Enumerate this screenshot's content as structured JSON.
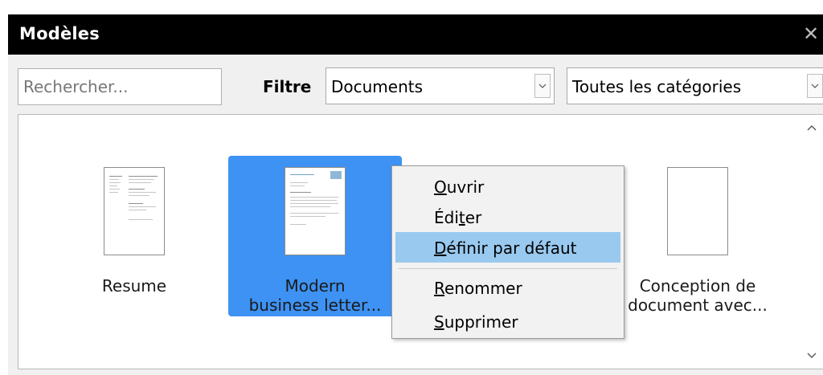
{
  "window": {
    "title": "Modèles",
    "close_icon": "close-icon"
  },
  "search": {
    "placeholder": "Rechercher...",
    "value": ""
  },
  "filter": {
    "label": "Filtre",
    "document_type": "Documents",
    "category": "Toutes les catégories"
  },
  "templates": [
    {
      "line1": "Resume",
      "line2": "",
      "selected": false
    },
    {
      "line1": "Modern",
      "line2": "business letter...",
      "selected": true
    },
    {
      "line1": "Conception de",
      "line2": "document avec...",
      "selected": false
    }
  ],
  "context_menu": {
    "items": [
      {
        "pre": "",
        "acc": "O",
        "post": "uvrir"
      },
      {
        "pre": "Édi",
        "acc": "t",
        "post": "er"
      },
      {
        "pre": "",
        "acc": "D",
        "post": "éfinir par défaut",
        "highlighted": true
      },
      {
        "pre": "",
        "acc": "R",
        "post": "enommer"
      },
      {
        "pre": "",
        "acc": "S",
        "post": "upprimer"
      }
    ]
  },
  "colors": {
    "titlebar": "#000000",
    "selection": "#3d92f3",
    "menu_highlight": "#99c9ef",
    "dialog_bg": "#f0f0f0"
  }
}
